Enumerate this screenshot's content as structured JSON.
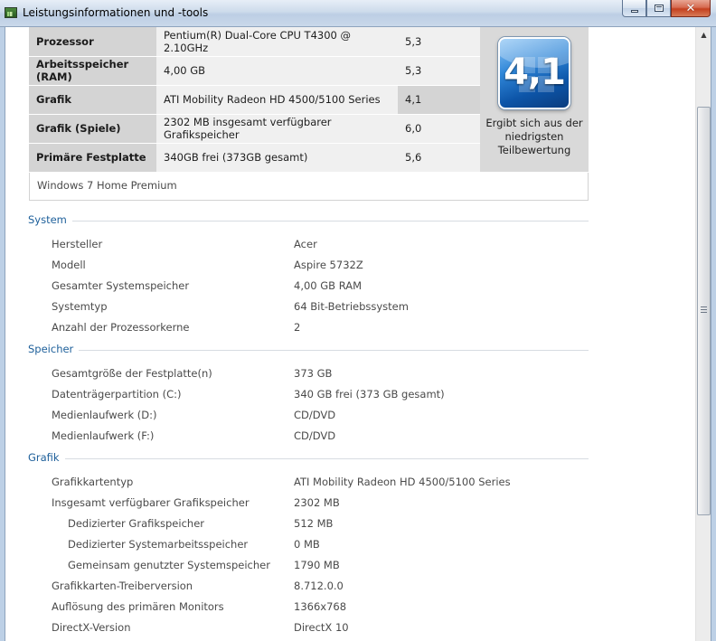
{
  "window": {
    "title": "Leistungsinformationen und -tools",
    "close_glyph": "✕"
  },
  "rating": {
    "rows": [
      {
        "name": "Prozessor",
        "detail": "Pentium(R) Dual-Core CPU T4300 @ 2.10GHz",
        "score": "5,3"
      },
      {
        "name": "Arbeitsspeicher (RAM)",
        "detail": "4,00 GB",
        "score": "5,3"
      },
      {
        "name": "Grafik",
        "detail": "ATI Mobility Radeon HD 4500/5100 Series",
        "score": "4,1"
      },
      {
        "name": "Grafik (Spiele)",
        "detail": "2302 MB insgesamt verfügbarer Grafikspeicher",
        "score": "6,0"
      },
      {
        "name": "Primäre Festplatte",
        "detail": "340GB frei (373GB gesamt)",
        "score": "5,6"
      }
    ],
    "base_score": "4,1",
    "caption": "Ergibt sich aus der niedrigsten Teilbewertung",
    "edition": "Windows 7 Home Premium"
  },
  "system": {
    "header": "System",
    "rows": [
      {
        "label": "Hersteller",
        "value": "Acer"
      },
      {
        "label": "Modell",
        "value": "Aspire 5732Z"
      },
      {
        "label": "Gesamter Systemspeicher",
        "value": "4,00 GB RAM"
      },
      {
        "label": "Systemtyp",
        "value": "64 Bit-Betriebssystem"
      },
      {
        "label": "Anzahl der Prozessorkerne",
        "value": "2"
      }
    ]
  },
  "storage": {
    "header": "Speicher",
    "rows": [
      {
        "label": "Gesamtgröße der Festplatte(n)",
        "value": "373 GB"
      },
      {
        "label": "Datenträgerpartition (C:)",
        "value": "340 GB frei (373 GB gesamt)"
      },
      {
        "label": "Medienlaufwerk (D:)",
        "value": "CD/DVD"
      },
      {
        "label": "Medienlaufwerk (F:)",
        "value": "CD/DVD"
      }
    ]
  },
  "graphics": {
    "header": "Grafik",
    "rows": [
      {
        "label": "Grafikkartentyp",
        "value": "ATI Mobility Radeon HD 4500/5100 Series"
      },
      {
        "label": "Insgesamt verfügbarer Grafikspeicher",
        "value": "2302 MB"
      },
      {
        "label": "Dedizierter Grafikspeicher",
        "value": "512 MB"
      },
      {
        "label": "Dedizierter Systemarbeitsspeicher",
        "value": "0 MB"
      },
      {
        "label": "Gemeinsam genutzter Systemspeicher",
        "value": "1790 MB"
      },
      {
        "label": "Grafikkarten-Treiberversion",
        "value": "8.712.0.0"
      },
      {
        "label": "Auflösung des primären Monitors",
        "value": "1366x768"
      },
      {
        "label": "DirectX-Version",
        "value": "DirectX 10"
      }
    ]
  },
  "icons": {
    "app": "performance-tools-icon",
    "minimize": "minimize-icon",
    "maximize": "maximize-icon",
    "close": "close-icon",
    "scroll_up": "scroll-up-arrow-icon",
    "badge": "windows-experience-index-badge"
  },
  "colors": {
    "section_header": "#1d5f9a",
    "badge_blue": "#2f86d8",
    "close_red": "#c4401f"
  }
}
